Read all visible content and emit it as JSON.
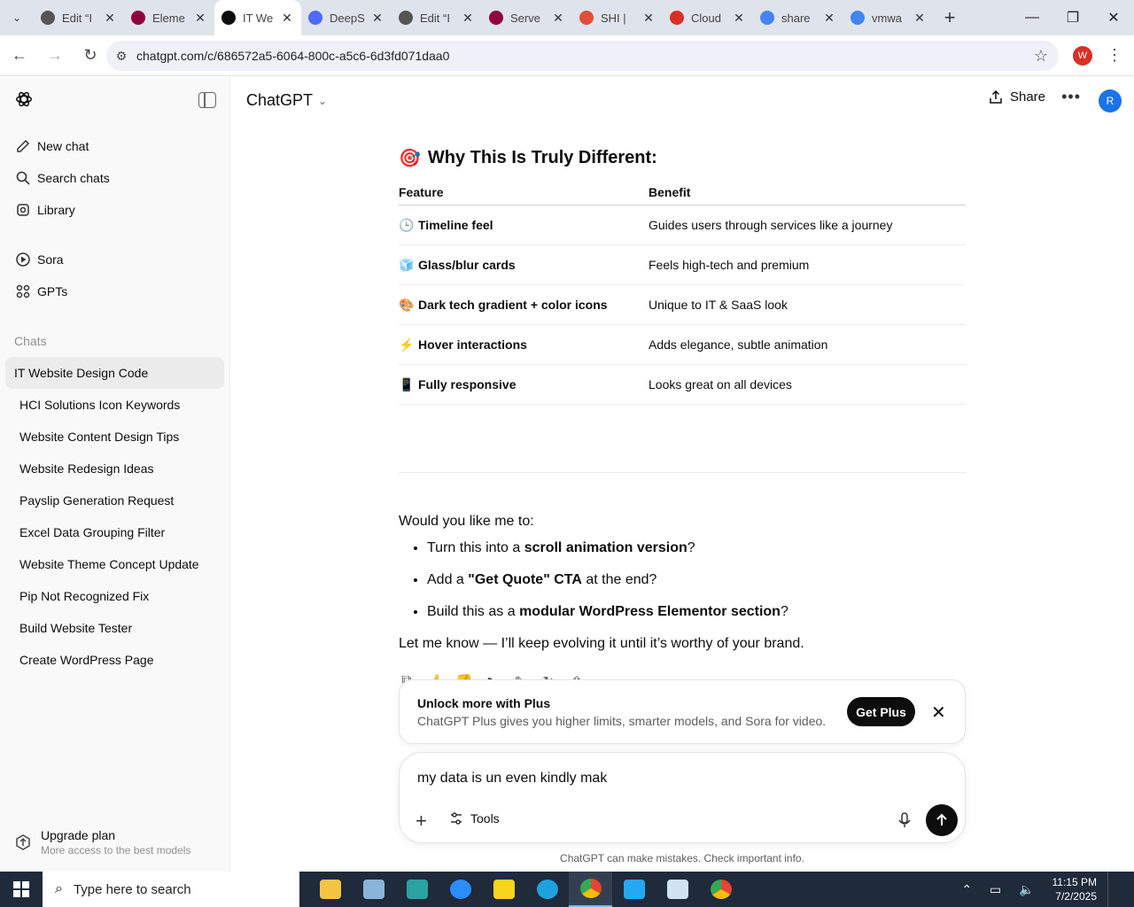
{
  "browser": {
    "tabs": [
      {
        "label": "Edit “I",
        "fav_color": "#555"
      },
      {
        "label": "Eleme",
        "fav_color": "#92003b"
      },
      {
        "label": "IT We",
        "fav_color": "#0d0d0d",
        "active": true
      },
      {
        "label": "DeepS",
        "fav_color": "#4d6bfe"
      },
      {
        "label": "Edit “I",
        "fav_color": "#555"
      },
      {
        "label": "Serve",
        "fav_color": "#92003b"
      },
      {
        "label": "SHI |",
        "fav_color": "#e04e39"
      },
      {
        "label": "Cloud",
        "fav_color": "#d93025"
      },
      {
        "label": "share",
        "fav_color": "#4285f4"
      },
      {
        "label": "vmwa",
        "fav_color": "#4285f4"
      }
    ],
    "url": "chatgpt.com/c/686572a5-6064-800c-a5c6-6d3fd071daa0",
    "profile_initial": "W"
  },
  "sidebar": {
    "top_items": [
      {
        "label": "New chat",
        "icon": "edit-icon"
      },
      {
        "label": "Search chats",
        "icon": "search-icon"
      },
      {
        "label": "Library",
        "icon": "library-icon"
      }
    ],
    "mid_items": [
      {
        "label": "Sora",
        "icon": "play-icon"
      },
      {
        "label": "GPTs",
        "icon": "grid-icon"
      }
    ],
    "section_label": "Chats",
    "chats": [
      "IT Website Design Code",
      "HCI Solutions Icon Keywords",
      "Website Content Design Tips",
      "Website Redesign Ideas",
      "Payslip Generation Request",
      "Excel Data Grouping Filter",
      "Website Theme Concept Update",
      "Pip Not Recognized Fix",
      "Build Website Tester",
      "Create WordPress Page"
    ],
    "active_chat_index": 0,
    "upgrade": {
      "title": "Upgrade plan",
      "subtitle": "More access to the best models"
    }
  },
  "header": {
    "model": "ChatGPT",
    "share": "Share",
    "user_initial": "R"
  },
  "message": {
    "heading_emoji": "🎯",
    "heading": "Why This Is Truly Different:",
    "table_headers": [
      "Feature",
      "Benefit"
    ],
    "rows": [
      {
        "emoji": "🕒",
        "feature": "Timeline feel",
        "benefit": "Guides users through services like a journey"
      },
      {
        "emoji": "🧊",
        "feature": "Glass/blur cards",
        "benefit": "Feels high-tech and premium"
      },
      {
        "emoji": "🎨",
        "feature": "Dark tech gradient + color icons",
        "benefit": "Unique to IT & SaaS look"
      },
      {
        "emoji": "⚡",
        "feature": "Hover interactions",
        "benefit": "Adds elegance, subtle animation"
      },
      {
        "emoji": "📱",
        "feature": "Fully responsive",
        "benefit": "Looks great on all devices"
      }
    ],
    "question": "Would you like me to:",
    "options": [
      {
        "pre": "Turn this into a ",
        "bold": "scroll animation version",
        "post": "?"
      },
      {
        "pre": "Add a ",
        "bold": "\"Get Quote\" CTA",
        "post": " at the end?"
      },
      {
        "pre": "Build this as a ",
        "bold": "modular WordPress Elementor section",
        "post": "?"
      }
    ],
    "closing": "Let me know — I’ll keep evolving it until it’s worthy of your brand."
  },
  "upsell": {
    "title": "Unlock more with Plus",
    "body": "ChatGPT Plus gives you higher limits, smarter models, and Sora for video.",
    "button": "Get Plus"
  },
  "composer": {
    "value": "my data is un even kindly mak",
    "tools_label": "Tools"
  },
  "disclaimer": "ChatGPT can make mistakes. Check important info.",
  "taskbar": {
    "search_placeholder": "Type here to search",
    "time": "11:15 PM",
    "date": "7/2/2025"
  }
}
